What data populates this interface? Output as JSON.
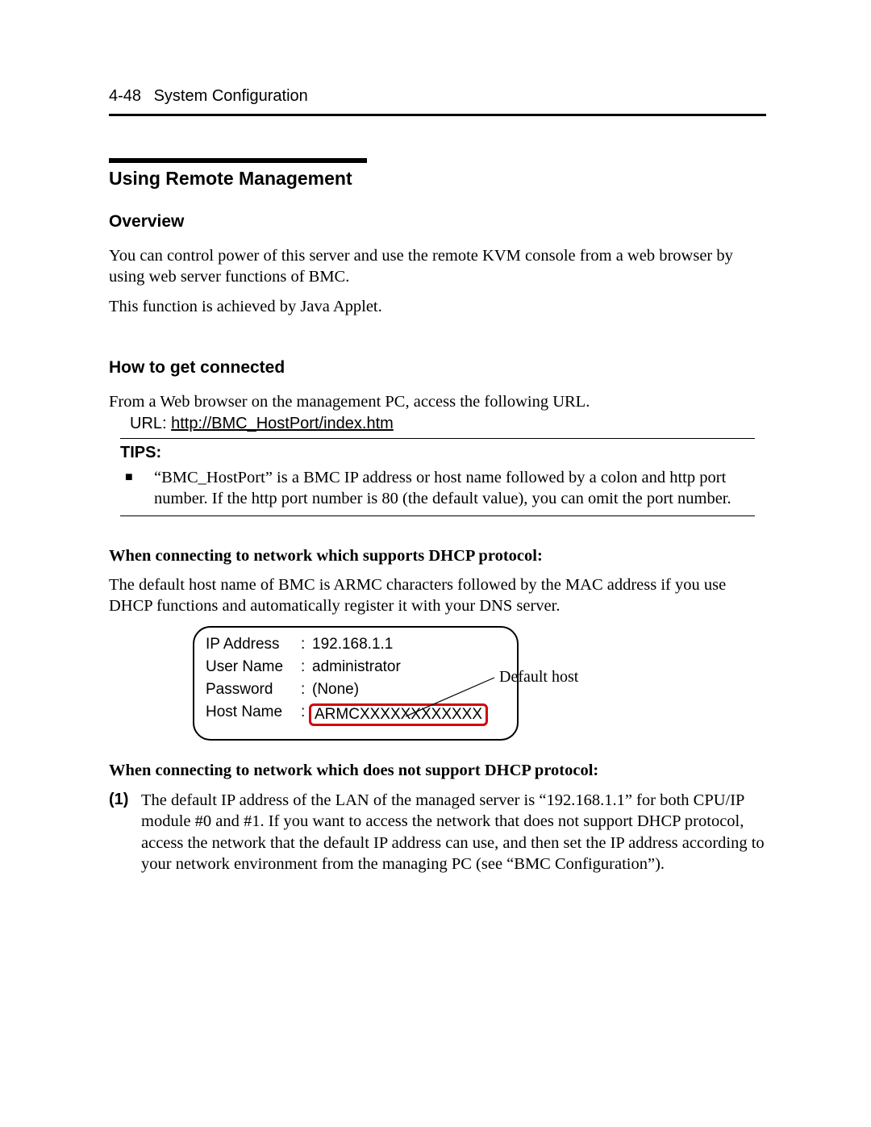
{
  "header": {
    "page_num": "4-48",
    "chapter": "System Configuration"
  },
  "section_title": "Using Remote Management",
  "overview": {
    "heading": "Overview",
    "p1": "You can control power of this server and use the remote KVM console from a web browser by using web server functions of BMC.",
    "p2": "This function is achieved by Java Applet."
  },
  "connect": {
    "heading": "How to get connected",
    "p1": "From a Web browser on the management PC, access the following URL.",
    "url_label": "URL: ",
    "url": "http://BMC_HostPort/index.htm"
  },
  "tips": {
    "label": "TIPS:",
    "item1": "“BMC_HostPort” is a BMC IP address or host name followed by a colon and http port number. If the http port number is 80 (the default value), you can omit the port number."
  },
  "dhcp_yes": {
    "heading": "When connecting to network which supports DHCP protocol:",
    "p1": "The default host name of BMC is ARMC characters followed by the MAC address if you use DHCP functions and automatically register it with your DNS server."
  },
  "infobox": {
    "ip_label": "IP Address",
    "ip_val": "192.168.1.1",
    "user_label": "User Name",
    "user_val": "administrator",
    "pass_label": "Password",
    "pass_val": "(None)",
    "host_label": "Host Name",
    "host_val": "ARMCXXXXXXXXXXXX",
    "callout": "Default host"
  },
  "dhcp_no": {
    "heading": "When connecting to network which does not support DHCP protocol:",
    "num": "(1)",
    "p1": "The default IP address of the LAN of the managed server is “192.168.1.1” for both CPU/IP module #0 and #1. If you want to access the network that does not support DHCP protocol, access the network that the default IP address can use, and then set the IP address according to your network environment from the managing PC (see “BMC Configuration”)."
  }
}
